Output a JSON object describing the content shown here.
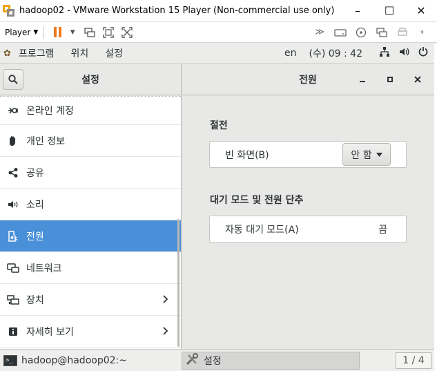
{
  "vm_window": {
    "title": "hadoop02 - VMware Workstation 15 Player (Non-commercial use only)",
    "minimize_glyph": "–",
    "maximize_glyph": "☐",
    "close_glyph": "✕"
  },
  "vm_toolbar": {
    "player_label": "Player",
    "accent_color": "#f07b1e"
  },
  "gnome_top_bar": {
    "menu_items": [
      "프로그램",
      "위치",
      "설정"
    ],
    "input_method": "en",
    "clock": "(수) 09 : 42"
  },
  "settings": {
    "sidebar_title": "설정",
    "panel_title": "전원",
    "sidebar_items": [
      {
        "label": "온라인 계정",
        "icon": "online-accounts-icon"
      },
      {
        "label": "개인 정보",
        "icon": "privacy-hand-icon"
      },
      {
        "label": "공유",
        "icon": "share-icon"
      },
      {
        "label": "소리",
        "icon": "speaker-icon"
      },
      {
        "label": "전원",
        "icon": "power-plug-icon",
        "active": true
      },
      {
        "label": "네트워크",
        "icon": "network-icon"
      },
      {
        "label": "장치",
        "icon": "devices-icon",
        "has_submenu": true
      },
      {
        "label": "자세히 보기",
        "icon": "info-icon",
        "has_submenu": true
      }
    ],
    "selection_color": "#4a90d9",
    "power_saving": {
      "section_title": "절전",
      "blank_screen_label": "빈 화면(B)",
      "blank_screen_value": "안 함"
    },
    "suspend": {
      "section_title": "대기 모드 및 전원 단추",
      "auto_suspend_label": "자동 대기 모드(A)",
      "auto_suspend_value": "끔"
    }
  },
  "taskbar": {
    "terminal_task": "hadoop@hadoop02:~",
    "settings_task": "설정",
    "workspace": "1 / 4"
  }
}
